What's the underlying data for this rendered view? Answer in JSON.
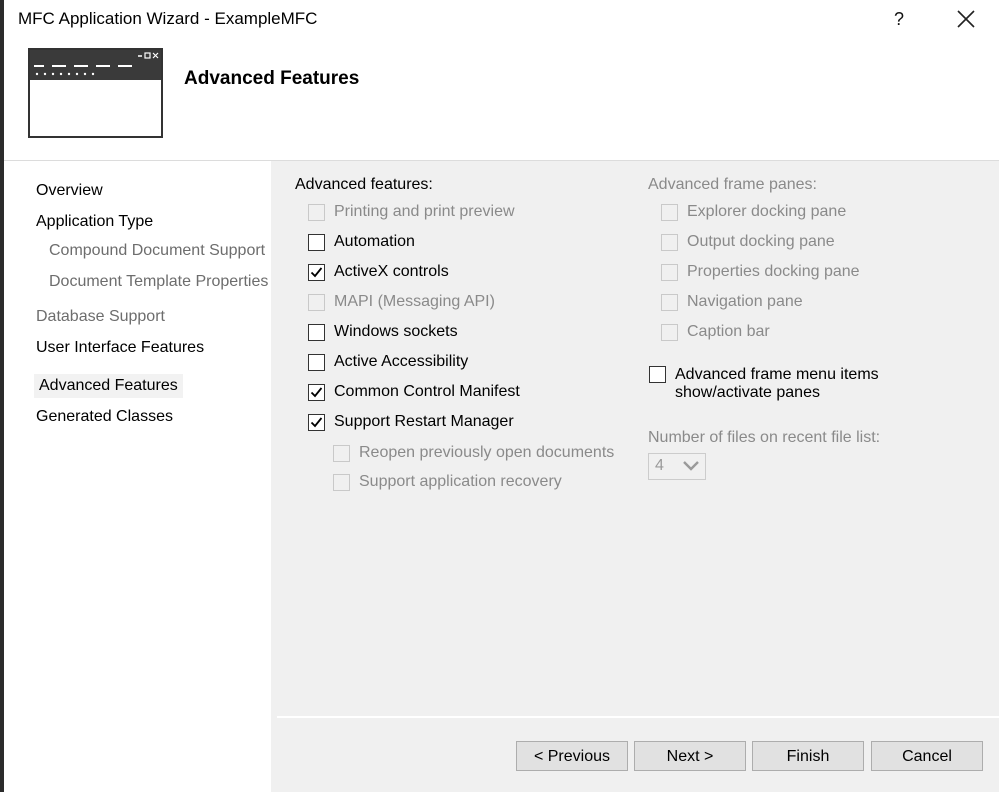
{
  "window": {
    "title": "MFC Application Wizard - ExampleMFC",
    "help_label": "?"
  },
  "header": {
    "title": "Advanced Features"
  },
  "nav": {
    "items": [
      {
        "label": "Overview",
        "state": "enabled"
      },
      {
        "label": "Application Type",
        "state": "enabled"
      },
      {
        "label": "Compound Document Support",
        "state": "dim"
      },
      {
        "label": "Document Template Properties",
        "state": "dim"
      },
      {
        "label": "Database Support",
        "state": "dim"
      },
      {
        "label": "User Interface Features",
        "state": "enabled"
      },
      {
        "label": "Advanced Features",
        "state": "selected"
      },
      {
        "label": "Generated Classes",
        "state": "enabled"
      }
    ]
  },
  "advanced_features": {
    "heading": "Advanced features:",
    "options": [
      {
        "label": "Printing and print preview",
        "checked": false,
        "enabled": false
      },
      {
        "label": "Automation",
        "checked": false,
        "enabled": true
      },
      {
        "label": "ActiveX controls",
        "checked": true,
        "enabled": true
      },
      {
        "label": "MAPI (Messaging API)",
        "checked": false,
        "enabled": false
      },
      {
        "label": "Windows sockets",
        "checked": false,
        "enabled": true
      },
      {
        "label": "Active Accessibility",
        "checked": false,
        "enabled": true
      },
      {
        "label": "Common Control Manifest",
        "checked": true,
        "enabled": true
      },
      {
        "label": "Support Restart Manager",
        "checked": true,
        "enabled": true
      },
      {
        "label": "Reopen previously open documents",
        "checked": false,
        "enabled": false
      },
      {
        "label": "Support application recovery",
        "checked": false,
        "enabled": false
      }
    ]
  },
  "frame_panes": {
    "heading": "Advanced frame panes:",
    "options": [
      {
        "label": "Explorer docking pane",
        "checked": false,
        "enabled": false
      },
      {
        "label": "Output docking pane",
        "checked": false,
        "enabled": false
      },
      {
        "label": "Properties docking pane",
        "checked": false,
        "enabled": false
      },
      {
        "label": "Navigation pane",
        "checked": false,
        "enabled": false
      },
      {
        "label": "Caption bar",
        "checked": false,
        "enabled": false
      }
    ],
    "menu_items_option": {
      "label": "Advanced frame menu items show/activate panes",
      "checked": false,
      "enabled": true
    }
  },
  "recent_files": {
    "label": "Number of files on recent file list:",
    "value": "4"
  },
  "buttons": {
    "previous": "< Previous",
    "next": "Next >",
    "finish": "Finish",
    "cancel": "Cancel"
  },
  "icons": {
    "close": "close-icon",
    "wizard": "wizard-window-icon",
    "checkmark": "checkmark-icon",
    "dropdown": "chevron-down-icon"
  }
}
